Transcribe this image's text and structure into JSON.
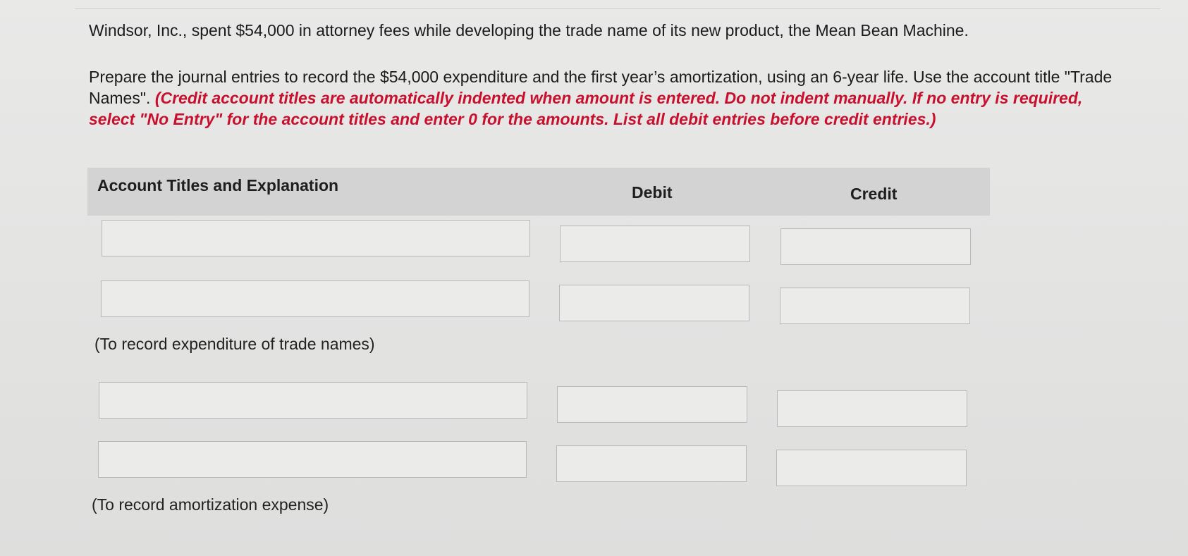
{
  "question": {
    "intro": "Windsor, Inc., spent $54,000 in attorney fees while developing the trade name of its new product, the Mean Bean Machine.",
    "instruction": "Prepare the journal entries to record the $54,000 expenditure and the first year’s amortization, using an 6-year life. Use the account title \"Trade Names\".",
    "note": "(Credit account titles are automatically indented when amount is entered. Do not indent manually. If no entry is required, select \"No Entry\" for the account titles and enter 0 for the amounts. List all debit entries before credit entries.)"
  },
  "table": {
    "headers": {
      "account": "Account Titles and Explanation",
      "debit": "Debit",
      "credit": "Credit"
    },
    "entries": [
      {
        "rows": [
          {
            "account": "",
            "debit": "",
            "credit": ""
          },
          {
            "account": "",
            "debit": "",
            "credit": ""
          }
        ],
        "explanation": "(To record expenditure of trade names)"
      },
      {
        "rows": [
          {
            "account": "",
            "debit": "",
            "credit": ""
          },
          {
            "account": "",
            "debit": "",
            "credit": ""
          }
        ],
        "explanation": "(To record amortization expense)"
      }
    ]
  }
}
